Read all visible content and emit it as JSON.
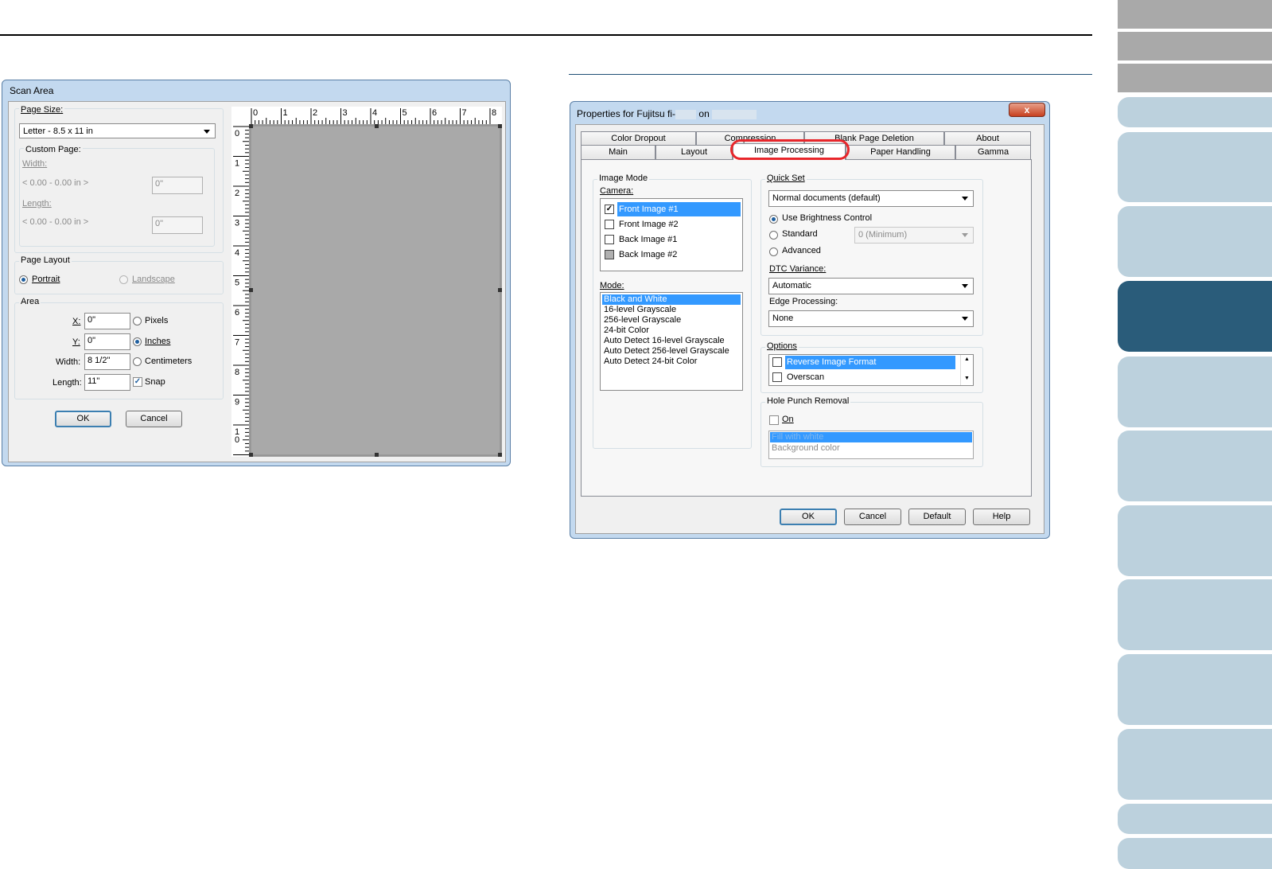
{
  "right_sidebar": {
    "tabs_count": 14
  },
  "scan_area": {
    "title": "Scan Area",
    "page_size_label": "Page Size:",
    "page_size_value": "Letter - 8.5 x 11 in",
    "custom_page_label": "Custom Page:",
    "width_label": "Width:",
    "width_range": "< 0.00 - 0.00 in >",
    "width_value": "0\"",
    "length_label": "Length:",
    "length_range": "< 0.00 - 0.00 in >",
    "length_value": "0\"",
    "page_layout_label": "Page Layout",
    "portrait_label": "Portrait",
    "landscape_label": "Landscape",
    "area_label": "Area",
    "x_label": "X:",
    "x_value": "0\"",
    "y_label": "Y:",
    "y_value": "0\"",
    "area_width_label": "Width:",
    "area_width_value": "8 1/2\"",
    "area_length_label": "Length:",
    "area_length_value": "11\"",
    "pixels_label": "Pixels",
    "inches_label": "Inches",
    "centimeters_label": "Centimeters",
    "snap_label": "Snap",
    "ok_label": "OK",
    "cancel_label": "Cancel",
    "ruler_h_labels": [
      "0",
      "1",
      "2",
      "3",
      "4",
      "5",
      "6",
      "7",
      "8"
    ],
    "ruler_v_labels": [
      "0",
      "1",
      "2",
      "3",
      "4",
      "5",
      "6",
      "7",
      "8",
      "9",
      "1",
      "0"
    ]
  },
  "properties": {
    "title_prefix": "Properties for Fujitsu fi-",
    "title_on": "on",
    "close_label": "x",
    "tabs_back": [
      "Color Dropout",
      "Compression",
      "Blank Page Deletion",
      "About"
    ],
    "tabs_front": [
      "Main",
      "Layout",
      "Image Processing",
      "Paper Handling",
      "Gamma"
    ],
    "active_tab": "Image Processing",
    "image_mode_label": "Image Mode",
    "camera_label": "Camera:",
    "camera_items": [
      {
        "label": "Front Image #1",
        "checked": true,
        "selected": true
      },
      {
        "label": "Front Image #2",
        "checked": false,
        "selected": false
      },
      {
        "label": "Back Image #1",
        "checked": false,
        "selected": false
      },
      {
        "label": "Back Image #2",
        "checked": false,
        "selected": false
      }
    ],
    "mode_label": "Mode:",
    "mode_items": [
      "Black and White",
      "16-level Grayscale",
      "256-level Grayscale",
      "24-bit Color",
      "Auto Detect 16-level Grayscale",
      "Auto Detect 256-level Grayscale",
      "Auto Detect 24-bit Color"
    ],
    "quick_set_label": "Quick Set",
    "quick_set_value": "Normal documents (default)",
    "use_brightness_label": "Use Brightness Control",
    "standard_label": "Standard",
    "standard_value": "0 (Minimum)",
    "advanced_label": "Advanced",
    "dtc_label": "DTC Variance:",
    "dtc_value": "Automatic",
    "edge_label": "Edge Processing:",
    "edge_value": "None",
    "options_label": "Options",
    "options_items": [
      "Reverse Image Format",
      "Overscan"
    ],
    "hole_punch_label": "Hole Punch Removal",
    "on_label": "On",
    "fill_items": [
      "Fill with white",
      "Background color"
    ],
    "ok_label": "OK",
    "cancel_label": "Cancel",
    "default_label": "Default",
    "help_label": "Help",
    "highlight_color": "#e8262b"
  }
}
